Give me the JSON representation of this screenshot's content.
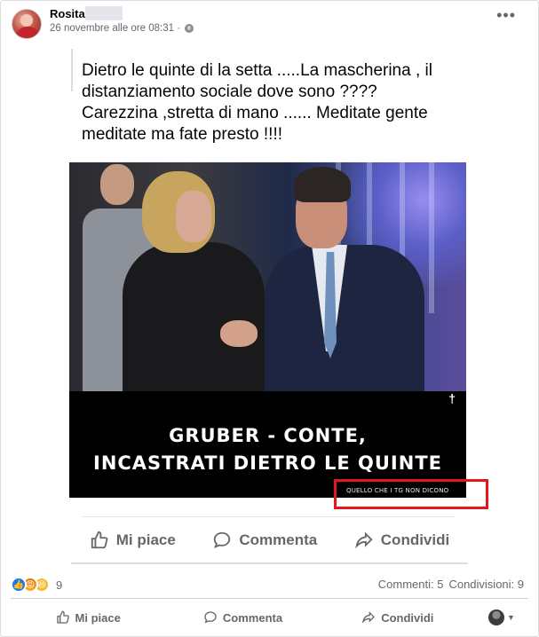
{
  "post": {
    "author": "Rosita I",
    "timestamp": "26 novembre alle ore 08:31 ·",
    "more_label": "•••"
  },
  "shared": {
    "text": "Dietro le quinte di la setta .....La mascherina , il distanziamento sociale dove sono ????\nCarezzina ,stretta di mano ...... Meditate gente meditate ma fate presto !!!!",
    "image": {
      "caption_line1": "GRUBER - CONTE,",
      "caption_line2": "INCASTRATI DIETRO LE QUINTE",
      "watermark": "QUELLO CHE I TG NON DICONO",
      "corner_mark": "†"
    },
    "actions": {
      "like": "Mi piace",
      "comment": "Commenta",
      "share": "Condividi"
    }
  },
  "reactions": {
    "count": "9",
    "comments": "Commenti: 5",
    "shares": "Condivisioni: 9"
  },
  "actions": {
    "like": "Mi piace",
    "comment": "Commenta",
    "share": "Condividi"
  },
  "colors": {
    "highlight": "#e3161c",
    "like_blue": "#1877f2",
    "muted_text": "#65676b"
  }
}
